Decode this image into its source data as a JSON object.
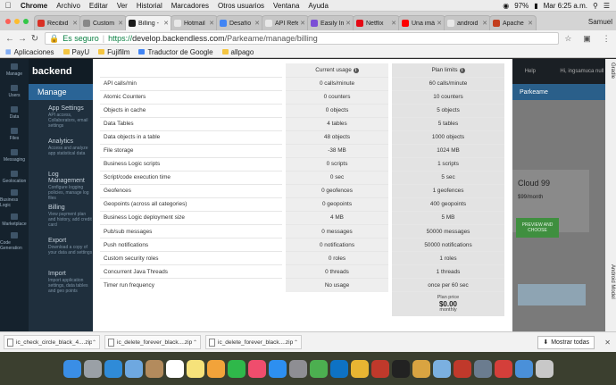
{
  "menubar": {
    "app_name": "Chrome",
    "items": [
      "Archivo",
      "Editar",
      "Ver",
      "Historial",
      "Marcadores",
      "Otros usuarios",
      "Ventana",
      "Ayuda"
    ],
    "battery": "97%",
    "clock": "Mar 6:25 a.m."
  },
  "tabs": [
    {
      "label": "Recibid",
      "color": "#d93025",
      "active": false
    },
    {
      "label": "Custom",
      "color": "#888888",
      "active": false
    },
    {
      "label": "Billing -",
      "color": "#1a1a1a",
      "active": true
    },
    {
      "label": "Hotmail",
      "color": "#e8e8e8",
      "active": false
    },
    {
      "label": "Desafío",
      "color": "#4285f4",
      "active": false
    },
    {
      "label": "API Refe",
      "color": "#e8e8e8",
      "active": false
    },
    {
      "label": "Easily In",
      "color": "#7b4fd6",
      "active": false
    },
    {
      "label": "Netflix",
      "color": "#e50914",
      "active": false
    },
    {
      "label": "Una imá",
      "color": "#ff0000",
      "active": false
    },
    {
      "label": "android",
      "color": "#e8e8e8",
      "active": false
    },
    {
      "label": "Apache",
      "color": "#c33e1e",
      "active": false
    }
  ],
  "profile_name": "Samuel",
  "address": {
    "secure_label": "Es seguro",
    "url_scheme": "https://",
    "url_host": "develop.backendless.com",
    "url_path": "/Parkeame/manage/billing"
  },
  "bookmarks": [
    {
      "label": "Aplicaciones"
    },
    {
      "label": "PayU"
    },
    {
      "label": "Fujifilm"
    },
    {
      "label": "Traductor de Google"
    },
    {
      "label": "allpago"
    }
  ],
  "app": {
    "logo_text": "backend",
    "manage_label": "Manage",
    "nav": [
      "Manage",
      "Users",
      "Data",
      "Files",
      "Messaging",
      "Geolocation",
      "Business Logic",
      "Marketplace",
      "Code Generation"
    ],
    "panel_items": [
      {
        "title": "App Settings",
        "sub": "API access, Collaborators, email settings"
      },
      {
        "title": "Analytics",
        "sub": "Access and analyze app statistical data"
      },
      {
        "title": "Log Management",
        "sub": "Configure logging policies, manage log files"
      },
      {
        "title": "Billing",
        "sub": "View payment plan and history, add credit card"
      },
      {
        "title": "Export",
        "sub": "Download a copy of your data and settings"
      },
      {
        "title": "Import",
        "sub": "Import application settings, data tables and geo points"
      }
    ],
    "right": {
      "help": "Help",
      "user": "Hi, ingsamuca null",
      "band_label": "Parkeame",
      "plan_name": "Cloud 99",
      "plan_price": "$99/month",
      "preview_button": "PREVIEW AND CHOOSE",
      "side_label_top": "Gradle",
      "side_label_bottom": "Android Model"
    }
  },
  "limits_table": {
    "header_current": "Current usage",
    "header_plan": "Plan limits",
    "rows": [
      {
        "name": "API calls/min",
        "current": "0 calls/minute",
        "plan": "60 calls/minute"
      },
      {
        "name": "Atomic Counters",
        "current": "0 counters",
        "plan": "10 counters"
      },
      {
        "name": "Objects in cache",
        "current": "0 objects",
        "plan": "5 objects"
      },
      {
        "name": "Data Tables",
        "current": "4 tables",
        "plan": "5 tables"
      },
      {
        "name": "Data objects in a table",
        "current": "48 objects",
        "plan": "1000 objects"
      },
      {
        "name": "File storage",
        "current": "-38 MB",
        "plan": "1024 MB"
      },
      {
        "name": "Business Logic scripts",
        "current": "0 scripts",
        "plan": "1 scripts"
      },
      {
        "name": "Script/code execution time",
        "current": "0 sec",
        "plan": "5 sec"
      },
      {
        "name": "Geofences",
        "current": "0 geofences",
        "plan": "1 geofences"
      },
      {
        "name": "Geopoints (across all categories)",
        "current": "0 geopoints",
        "plan": "400 geopoints"
      },
      {
        "name": "Business Logic deployment size",
        "current": "4 MB",
        "plan": "5 MB"
      },
      {
        "name": "Pub/sub messages",
        "current": "0 messages",
        "plan": "50000 messages"
      },
      {
        "name": "Push notifications",
        "current": "0 notifications",
        "plan": "50000 notifications"
      },
      {
        "name": "Custom security roles",
        "current": "0 roles",
        "plan": "1 roles"
      },
      {
        "name": "Concurrent Java Threads",
        "current": "0 threads",
        "plan": "1 threads"
      },
      {
        "name": "Timer run frequency",
        "current": "No usage",
        "plan": "once per 60 sec"
      }
    ],
    "plan_price_label": "Plan price",
    "plan_price_value": "$0.00",
    "plan_price_period": "monthly"
  },
  "downloads": [
    {
      "filename": "ic_check_circle_black_4....zip"
    },
    {
      "filename": "ic_delete_forever_black....zip"
    },
    {
      "filename": "ic_delete_forever_black....zip"
    }
  ],
  "show_all_label": "Mostrar todas",
  "dock_apps": [
    {
      "name": "finder-icon",
      "color": "#3a8ee6"
    },
    {
      "name": "launchpad-icon",
      "color": "#9aa0a6"
    },
    {
      "name": "safari-icon",
      "color": "#2f8bd8"
    },
    {
      "name": "mail-icon",
      "color": "#6ea8e0"
    },
    {
      "name": "contacts-icon",
      "color": "#b38b5d"
    },
    {
      "name": "calendar-icon",
      "color": "#ffffff"
    },
    {
      "name": "notes-icon",
      "color": "#f6e27a"
    },
    {
      "name": "photos-icon",
      "color": "#f2a33a"
    },
    {
      "name": "facetime-icon",
      "color": "#2fb84a"
    },
    {
      "name": "music-icon",
      "color": "#ef4d6d"
    },
    {
      "name": "app-store-icon",
      "color": "#2d8ff0"
    },
    {
      "name": "preferences-icon",
      "color": "#8e8e93"
    },
    {
      "name": "android-studio-icon",
      "color": "#4caf50"
    },
    {
      "name": "teamviewer-icon",
      "color": "#0e72c4"
    },
    {
      "name": "chrome-icon",
      "color": "#e8b532"
    },
    {
      "name": "filezilla-icon",
      "color": "#c0392b"
    },
    {
      "name": "terminal-icon",
      "color": "#222222"
    },
    {
      "name": "coduo-icon",
      "color": "#d9a441"
    },
    {
      "name": "xcode-icon",
      "color": "#7bb0e0"
    },
    {
      "name": "flickr-icon",
      "color": "#c0392b"
    },
    {
      "name": "sequel-icon",
      "color": "#6b7c8f"
    },
    {
      "name": "screen-icon",
      "color": "#d43f3a"
    },
    {
      "name": "downloads-folder-icon",
      "color": "#4a90d9"
    },
    {
      "name": "trash-icon",
      "color": "#c8c8c8"
    }
  ]
}
